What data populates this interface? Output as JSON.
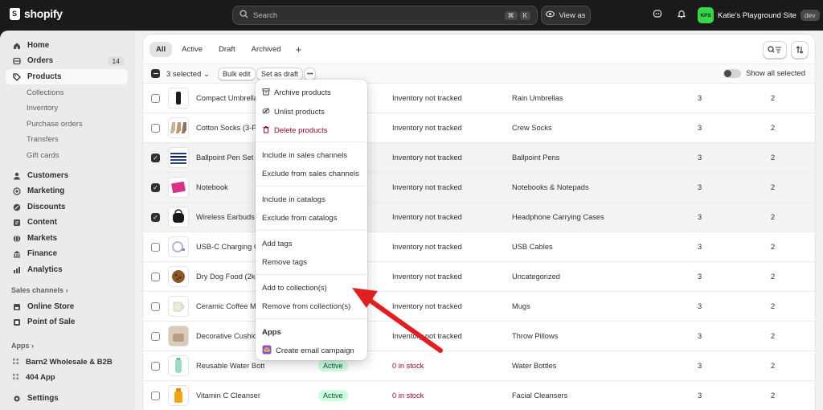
{
  "topbar": {
    "brand": "shopify",
    "search_placeholder": "Search",
    "shortcut_keys": [
      "⌘",
      "K"
    ],
    "view_as_label": "View as",
    "store_initials": "KPS",
    "store_name": "Katie's Playground Site",
    "store_badge": "dev"
  },
  "sidebar": {
    "main_items": [
      {
        "label": "Home",
        "icon": "home-icon"
      },
      {
        "label": "Orders",
        "icon": "orders-icon",
        "badge": "14"
      },
      {
        "label": "Products",
        "icon": "tag-icon",
        "active": true
      }
    ],
    "product_subitems": [
      "Collections",
      "Inventory",
      "Purchase orders",
      "Transfers",
      "Gift cards"
    ],
    "more_items": [
      {
        "label": "Customers",
        "icon": "person-icon"
      },
      {
        "label": "Marketing",
        "icon": "target-icon"
      },
      {
        "label": "Discounts",
        "icon": "discount-icon"
      },
      {
        "label": "Content",
        "icon": "content-icon"
      },
      {
        "label": "Markets",
        "icon": "globe-icon"
      },
      {
        "label": "Finance",
        "icon": "bank-icon"
      },
      {
        "label": "Analytics",
        "icon": "analytics-icon"
      }
    ],
    "sales_channels_heading": "Sales channels",
    "sales_channels": [
      {
        "label": "Online Store",
        "icon": "store-icon"
      },
      {
        "label": "Point of Sale",
        "icon": "pos-icon"
      }
    ],
    "apps_heading": "Apps",
    "apps": [
      "Barn2 Wholesale & B2B",
      "404 App"
    ],
    "settings_label": "Settings"
  },
  "tabs": [
    {
      "label": "All",
      "selected": true
    },
    {
      "label": "Active"
    },
    {
      "label": "Draft"
    },
    {
      "label": "Archived"
    },
    {
      "label": "+"
    }
  ],
  "bulk": {
    "selected_text": "3 selected",
    "bulk_edit": "Bulk edit",
    "set_as_draft": "Set as draft",
    "more": "•••",
    "show_all_selected": "Show all selected"
  },
  "rows": [
    {
      "name": "Compact Umbrella",
      "inventory": "Inventory not tracked",
      "type": "Rain Umbrellas",
      "n1": "3",
      "n2": "2",
      "checked": false
    },
    {
      "name": "Cotton Socks (3-Pack)",
      "inventory": "Inventory not tracked",
      "type": "Crew Socks",
      "n1": "3",
      "n2": "2",
      "checked": false
    },
    {
      "name": "Ballpoint Pen Set",
      "inventory": "Inventory not tracked",
      "type": "Ballpoint Pens",
      "n1": "3",
      "n2": "2",
      "checked": true
    },
    {
      "name": "Notebook",
      "inventory": "Inventory not tracked",
      "type": "Notebooks & Notepads",
      "n1": "3",
      "n2": "2",
      "checked": true
    },
    {
      "name": "Wireless Earbuds Case",
      "inventory": "Inventory not tracked",
      "type": "Headphone Carrying Cases",
      "n1": "3",
      "n2": "2",
      "checked": true
    },
    {
      "name": "USB-C Charging Cable",
      "inventory": "Inventory not tracked",
      "type": "USB Cables",
      "n1": "3",
      "n2": "2",
      "checked": false
    },
    {
      "name": "Dry Dog Food (2kg)",
      "inventory": "Inventory not tracked",
      "type": "Uncategorized",
      "n1": "3",
      "n2": "2",
      "checked": false
    },
    {
      "name": "Ceramic Coffee Mug",
      "inventory": "Inventory not tracked",
      "type": "Mugs",
      "n1": "3",
      "n2": "2",
      "checked": false
    },
    {
      "name": "Decorative Cushion",
      "inventory": "Inventory not tracked",
      "type": "Throw Pillows",
      "n1": "3",
      "n2": "2",
      "checked": false
    },
    {
      "name": "Reusable Water Bottle",
      "status": "Active",
      "inventory": "0 in stock",
      "type": "Water Bottles",
      "n1": "3",
      "n2": "2",
      "checked": false
    },
    {
      "name": "Vitamin C Cleanser",
      "status": "Active",
      "inventory": "0 in stock",
      "type": "Facial Cleansers",
      "n1": "3",
      "n2": "2",
      "checked": false
    }
  ],
  "menu": {
    "archive": "Archive products",
    "unlist": "Unlist products",
    "delete": "Delete products",
    "include_sales": "Include in sales channels",
    "exclude_sales": "Exclude from sales channels",
    "include_catalogs": "Include in catalogs",
    "exclude_catalogs": "Exclude from catalogs",
    "add_tags": "Add tags",
    "remove_tags": "Remove tags",
    "add_collections": "Add to collection(s)",
    "remove_collections": "Remove from collection(s)",
    "apps_heading": "Apps",
    "email_campaign": "Create email campaign"
  },
  "colors": {
    "accent_active_badge": "#cdfee1",
    "danger": "#8e0b21",
    "annotation_arrow": "#e02020",
    "store_avatar": "#36d84a"
  }
}
